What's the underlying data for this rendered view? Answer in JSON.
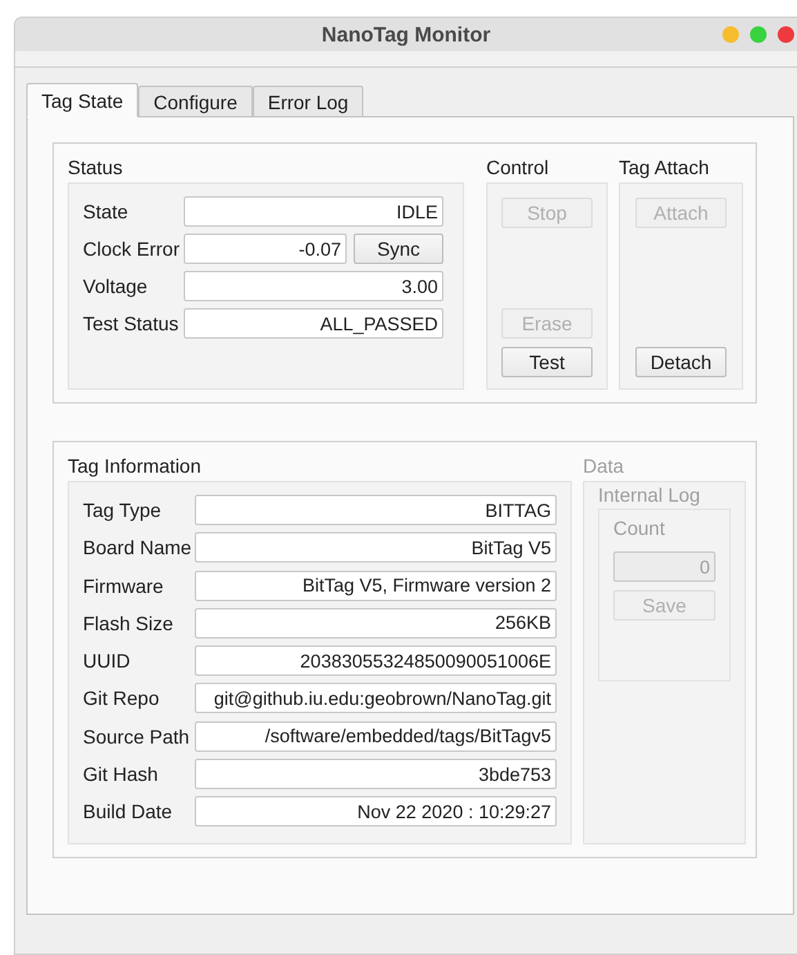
{
  "window": {
    "title": "NanoTag Monitor",
    "controls": [
      {
        "color": "#f6bd2f"
      },
      {
        "color": "#38d33f"
      },
      {
        "color": "#ee3a3f"
      }
    ]
  },
  "tabs": [
    {
      "label": "Tag State",
      "selected": true
    },
    {
      "label": "Configure",
      "selected": false
    },
    {
      "label": "Error Log",
      "selected": false
    }
  ],
  "status": {
    "title": "Status",
    "fields": [
      {
        "label": "State",
        "value": "IDLE"
      },
      {
        "label": "Clock Error",
        "value": "-0.07",
        "button": "Sync"
      },
      {
        "label": "Voltage",
        "value": "3.00"
      },
      {
        "label": "Test Status",
        "value": "ALL_PASSED"
      }
    ]
  },
  "control": {
    "title": "Control",
    "top_buttons": [
      {
        "label": "Stop",
        "disabled": true
      }
    ],
    "bottom_buttons": [
      {
        "label": "Erase",
        "disabled": true
      },
      {
        "label": "Test",
        "disabled": false
      }
    ]
  },
  "tag_attach": {
    "title": "Tag Attach",
    "top_buttons": [
      {
        "label": "Attach",
        "disabled": true
      }
    ],
    "bottom_buttons": [
      {
        "label": "Detach",
        "disabled": false
      }
    ]
  },
  "tag_information": {
    "title": "Tag Information",
    "fields": [
      {
        "label": "Tag Type",
        "value": "BITTAG"
      },
      {
        "label": "Board Name",
        "value": "BitTag V5"
      },
      {
        "label": "Firmware",
        "value": "BitTag V5, Firmware version 2"
      },
      {
        "label": "Flash Size",
        "value": "256KB"
      },
      {
        "label": "UUID",
        "value": "20383055324850090051006E"
      },
      {
        "label": "Git Repo",
        "value": "git@github.iu.edu:geobrown/NanoTag.git"
      },
      {
        "label": "Source Path",
        "value": "/software/embedded/tags/BitTagv5"
      },
      {
        "label": "Git Hash",
        "value": "3bde753"
      },
      {
        "label": "Build Date",
        "value": "Nov 22 2020 : 10:29:27"
      }
    ]
  },
  "data": {
    "title": "Data",
    "disabled": true,
    "internal_log": {
      "title": "Internal Log",
      "count_label": "Count",
      "count_value": "0",
      "button": "Save"
    }
  }
}
